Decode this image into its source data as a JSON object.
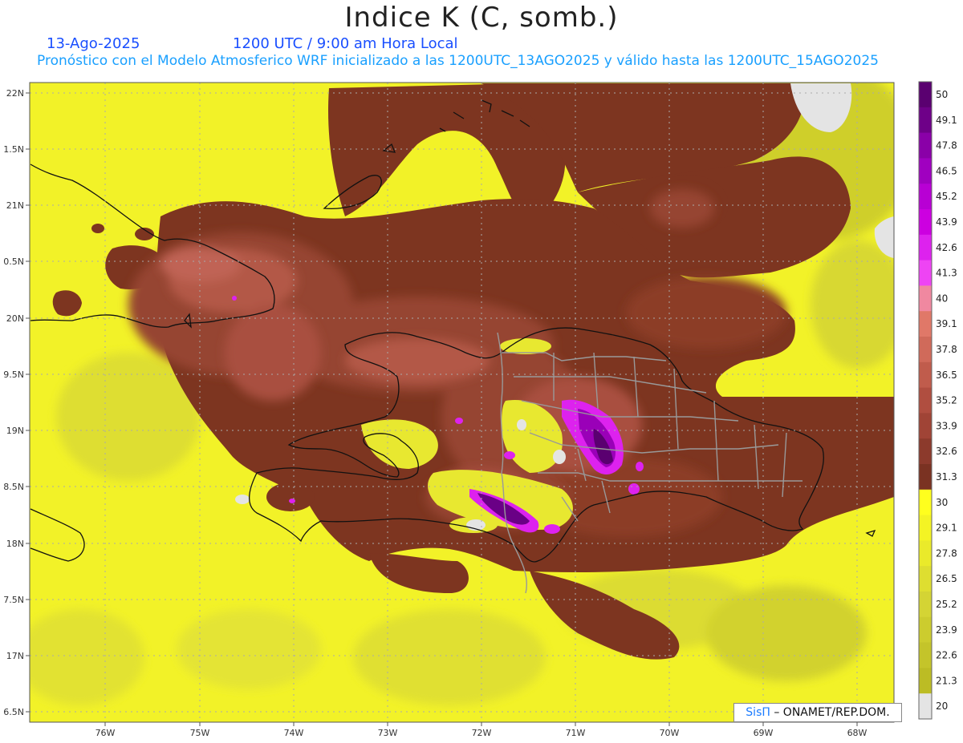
{
  "title": "Indice K (C, somb.)",
  "header": {
    "date": "13-Ago-2025",
    "time": "1200 UTC / 9:00 am Hora Local",
    "description": "Pronóstico con el Modelo Atmosferico WRF inicializado a las 1200UTC_13AGO2025 y válido hasta las  1200UTC_15AGO2025"
  },
  "axes": {
    "lat_labels": [
      "22N",
      "1.5N",
      "21N",
      "0.5N",
      "20N",
      "9.5N",
      "19N",
      "8.5N",
      "18N",
      "7.5N",
      "17N",
      "6.5N"
    ],
    "lon_labels": [
      "76W",
      "75W",
      "74W",
      "73W",
      "72W",
      "71W",
      "70W",
      "69W",
      "68W"
    ]
  },
  "colorbar": {
    "labels": [
      "50",
      "49.1",
      "47.8",
      "46.5",
      "45.2",
      "43.9",
      "42.6",
      "41.3",
      "40",
      "39.1",
      "37.8",
      "36.5",
      "35.2",
      "33.9",
      "32.6",
      "31.3",
      "30",
      "29.1",
      "27.8",
      "26.5",
      "25.2",
      "23.9",
      "22.6",
      "21.3",
      "20"
    ],
    "colors": [
      "#5a0070",
      "#6e0088",
      "#8a00a8",
      "#a000c0",
      "#b800d4",
      "#cc00e0",
      "#dd22ee",
      "#ee44f4",
      "#f088a0",
      "#e07868",
      "#d06a5a",
      "#c05c4c",
      "#b04e40",
      "#a04436",
      "#8c3a2c",
      "#7a3222",
      "#ffff1e",
      "#f4f424",
      "#eaea2a",
      "#dede30",
      "#d4d434",
      "#cccc2e",
      "#c4c42a",
      "#bcbc24",
      "#e4e4e4"
    ]
  },
  "credit": {
    "brand": "SisΠ",
    "text": "– ONAMET/REP.DOM."
  }
}
